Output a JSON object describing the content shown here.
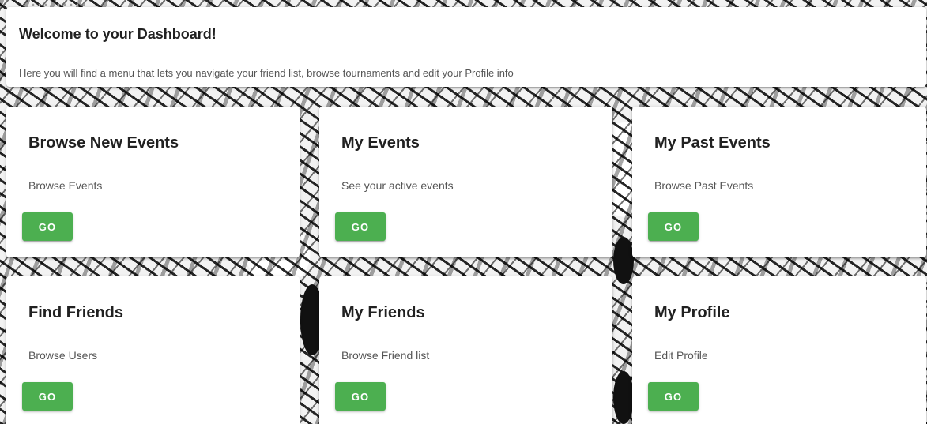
{
  "welcome": {
    "title": "Welcome to your Dashboard!",
    "subtitle": "Here you will find a menu that lets you navigate your friend list, browse tournaments and edit your Profile info"
  },
  "cards": [
    {
      "title": "Browse New Events",
      "subtitle": "Browse Events",
      "button": "GO"
    },
    {
      "title": "My Events",
      "subtitle": "See your active events",
      "button": "GO"
    },
    {
      "title": "My Past Events",
      "subtitle": "Browse Past Events",
      "button": "GO"
    },
    {
      "title": "Find Friends",
      "subtitle": "Browse Users",
      "button": "GO"
    },
    {
      "title": "My Friends",
      "subtitle": "Browse Friend list",
      "button": "GO"
    },
    {
      "title": "My Profile",
      "subtitle": "Edit Profile",
      "button": "GO"
    }
  ],
  "colors": {
    "accent": "#4caf50",
    "card_bg": "#ffffff",
    "title_text": "#212121",
    "body_text": "#555555"
  }
}
